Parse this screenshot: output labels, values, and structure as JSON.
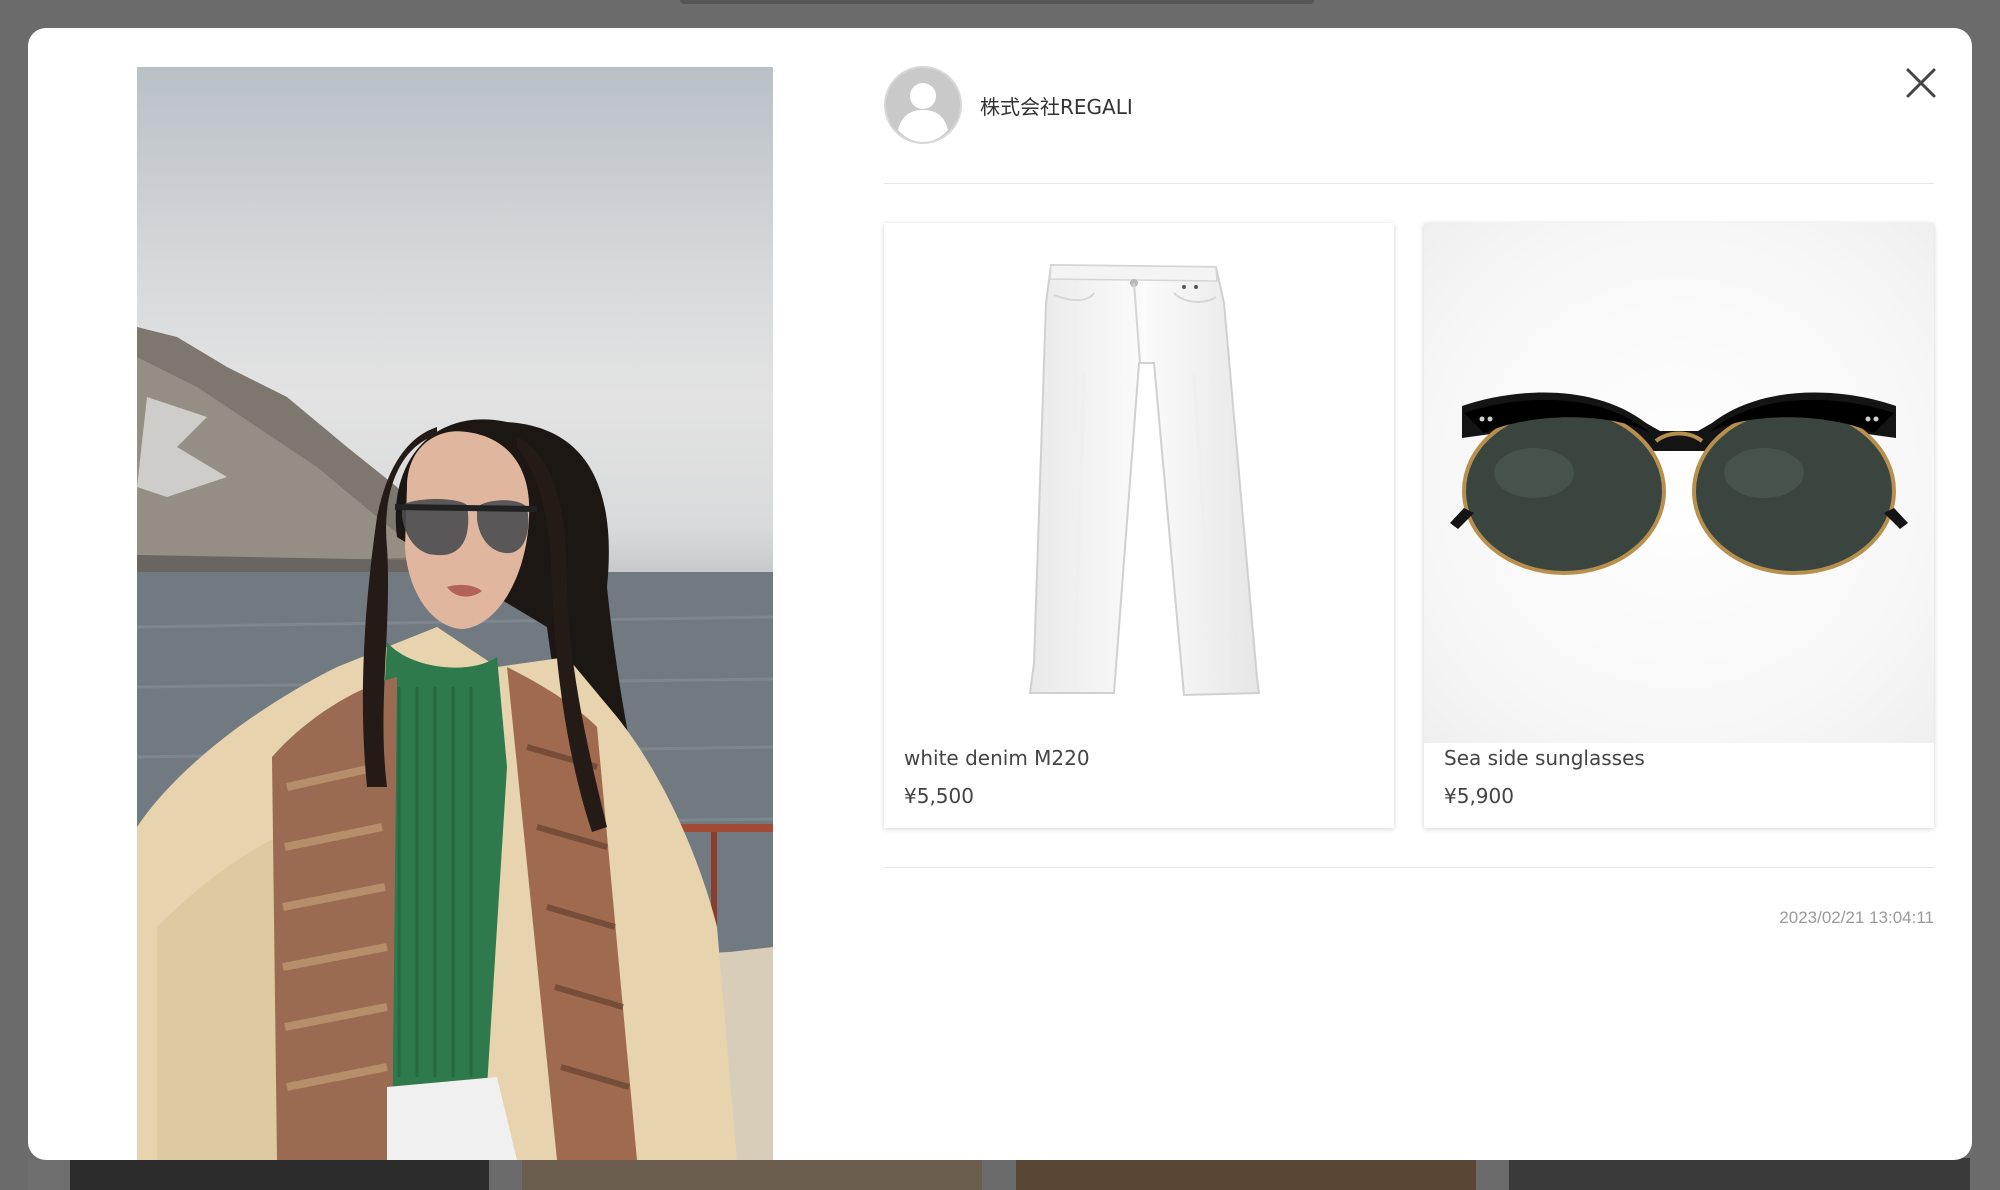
{
  "author": {
    "name": "株式会社REGALI",
    "avatar_icon": "user-avatar-icon"
  },
  "close_icon": "close-icon",
  "products": [
    {
      "name": "white denim M220",
      "price": "¥5,500",
      "image": "white-pants-image"
    },
    {
      "name": "Sea side sunglasses",
      "price": "¥5,900",
      "image": "sunglasses-image"
    }
  ],
  "timestamp": "2023/02/21 13:04:11",
  "colors": {
    "overlay": "#6b6b6b",
    "modal_bg": "#ffffff",
    "text": "#444444",
    "muted": "#9a9a9a"
  }
}
